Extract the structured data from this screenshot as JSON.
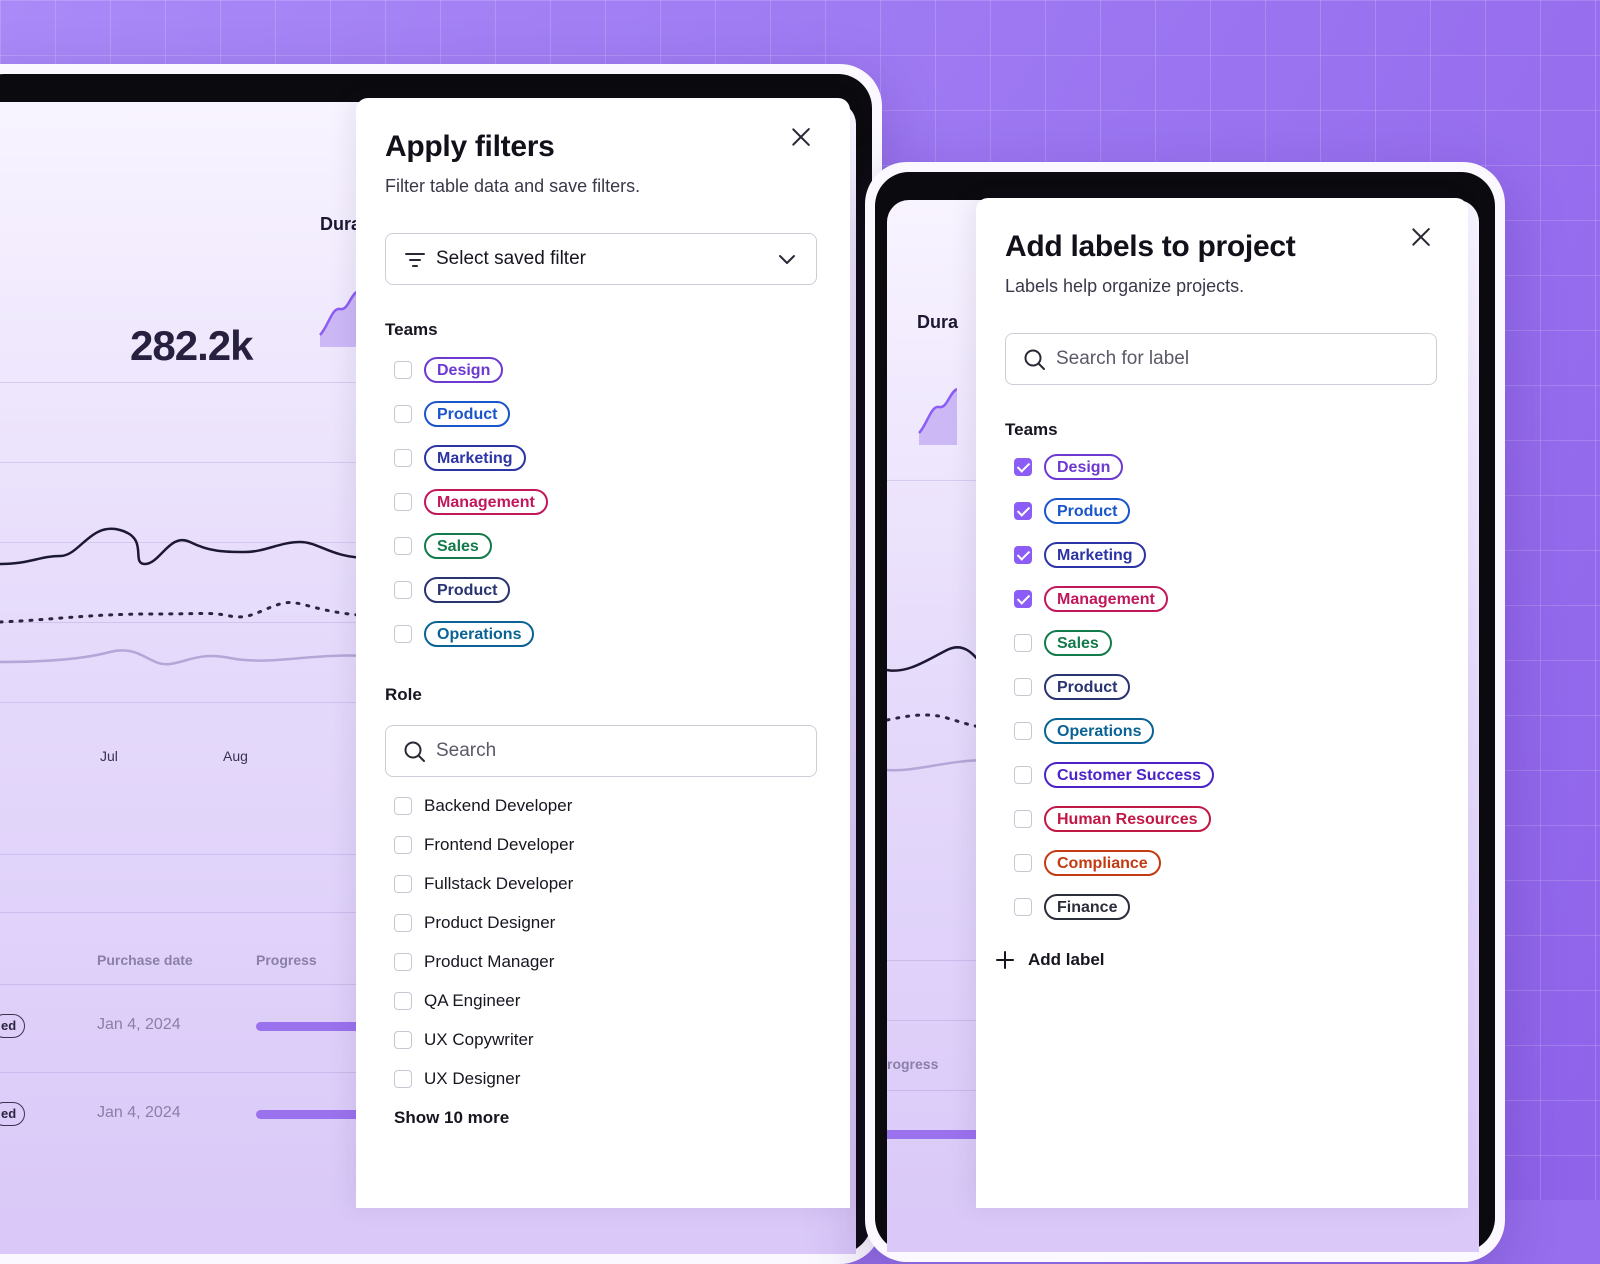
{
  "colors": {
    "accent": "#8b5cf6",
    "design": "#6d3ad1",
    "product": "#1a56c9",
    "marketing": "#2d35a6",
    "management": "#c2185b",
    "sales": "#137a4b",
    "product_dark": "#2a3470",
    "operations": "#0a6394",
    "customer_success": "#4a22c8",
    "human_resources": "#c21845",
    "compliance": "#c23b12",
    "finance": "#2b2d3a"
  },
  "dashboard": {
    "metric": "282.2k",
    "metric_label_1": "Dura",
    "metric_label_2": "Dura",
    "axis": [
      "Jul",
      "Aug"
    ],
    "table_headers": [
      "Purchase date",
      "Progress"
    ],
    "rows": [
      {
        "date": "Jan 4, 2024",
        "badge": "ed"
      },
      {
        "date": "Jan 4, 2024",
        "badge": "ed"
      }
    ],
    "second_header": "rogress"
  },
  "filters": {
    "title": "Apply filters",
    "subtitle": "Filter table data and save filters.",
    "saved_filter_label": "Select saved filter",
    "teams_heading": "Teams",
    "teams": [
      {
        "label": "Design",
        "checked": false,
        "color": "#6d3ad1"
      },
      {
        "label": "Product",
        "checked": false,
        "color": "#1a56c9"
      },
      {
        "label": "Marketing",
        "checked": false,
        "color": "#2d35a6"
      },
      {
        "label": "Management",
        "checked": false,
        "color": "#c2185b"
      },
      {
        "label": "Sales",
        "checked": false,
        "color": "#137a4b"
      },
      {
        "label": "Product",
        "checked": false,
        "color": "#2a3470"
      },
      {
        "label": "Operations",
        "checked": false,
        "color": "#0a6394"
      }
    ],
    "role_heading": "Role",
    "role_search_placeholder": "Search",
    "roles": [
      "Backend Developer",
      "Frontend Developer",
      "Fullstack Developer",
      "Product Designer",
      "Product Manager",
      "QA Engineer",
      "UX Copywriter",
      "UX Designer"
    ],
    "show_more": "Show 10 more"
  },
  "labels": {
    "title": "Add labels to project",
    "subtitle": "Labels help organize projects.",
    "search_placeholder": "Search for label",
    "teams_heading": "Teams",
    "teams": [
      {
        "label": "Design",
        "checked": true,
        "color": "#6d3ad1"
      },
      {
        "label": "Product",
        "checked": true,
        "color": "#1a56c9"
      },
      {
        "label": "Marketing",
        "checked": true,
        "color": "#2d35a6"
      },
      {
        "label": "Management",
        "checked": true,
        "color": "#c2185b"
      },
      {
        "label": "Sales",
        "checked": false,
        "color": "#137a4b"
      },
      {
        "label": "Product",
        "checked": false,
        "color": "#2a3470"
      },
      {
        "label": "Operations",
        "checked": false,
        "color": "#0a6394"
      },
      {
        "label": "Customer Success",
        "checked": false,
        "color": "#4a22c8"
      },
      {
        "label": "Human Resources",
        "checked": false,
        "color": "#c21845"
      },
      {
        "label": "Compliance",
        "checked": false,
        "color": "#c23b12"
      },
      {
        "label": "Finance",
        "checked": false,
        "color": "#2b2d3a"
      }
    ],
    "add_label": "Add label"
  }
}
